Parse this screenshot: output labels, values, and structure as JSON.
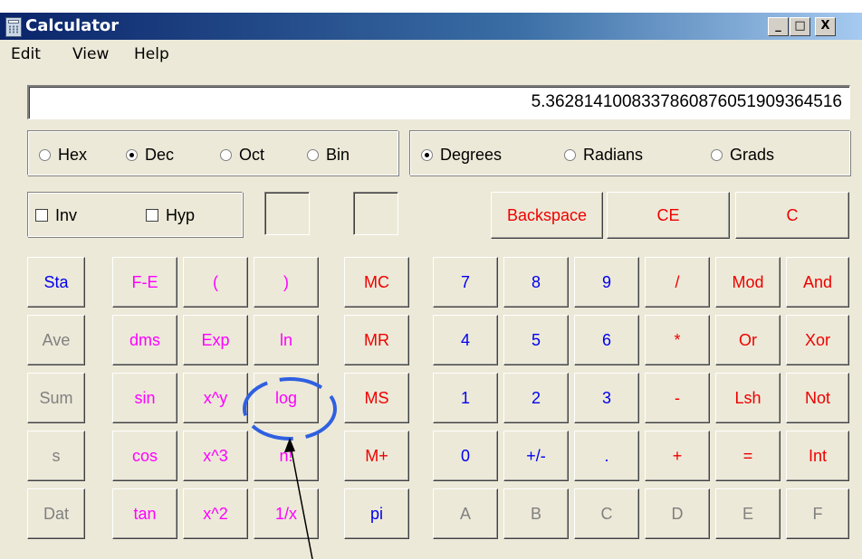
{
  "window": {
    "title": "Calculator"
  },
  "title_buttons": [
    "_",
    "□",
    "X"
  ],
  "menu": {
    "items": [
      "Edit",
      "View",
      "Help"
    ]
  },
  "display": {
    "value": "5.3628141008337860876051909364516"
  },
  "radix_options": [
    {
      "label": "Hex",
      "selected": false
    },
    {
      "label": "Dec",
      "selected": true
    },
    {
      "label": "Oct",
      "selected": false
    },
    {
      "label": "Bin",
      "selected": false
    }
  ],
  "angle_options": [
    {
      "label": "Degrees",
      "selected": true
    },
    {
      "label": "Radians",
      "selected": false
    },
    {
      "label": "Grads",
      "selected": false
    }
  ],
  "checkboxes": [
    {
      "label": "Inv",
      "checked": false
    },
    {
      "label": "Hyp",
      "checked": false
    }
  ],
  "edit_buttons": [
    {
      "label": "Backspace",
      "color": "#ee0000"
    },
    {
      "label": "CE",
      "color": "#ee0000"
    },
    {
      "label": "C",
      "color": "#ee0000"
    }
  ],
  "stat_buttons": [
    {
      "label": "Sta",
      "color": "#0000ee"
    },
    {
      "label": "Ave",
      "color": "#808080"
    },
    {
      "label": "Sum",
      "color": "#808080"
    },
    {
      "label": "s",
      "color": "#808080"
    },
    {
      "label": "Dat",
      "color": "#808080"
    }
  ],
  "func_col1": [
    "F-E",
    "dms",
    "sin",
    "cos",
    "tan"
  ],
  "func_col2": [
    "(",
    "Exp",
    "x^y",
    "x^3",
    "x^2"
  ],
  "func_col3": [
    ")",
    "ln",
    "log",
    "n!",
    "1/x"
  ],
  "memory_buttons": [
    {
      "label": "MC",
      "color": "#ee0000"
    },
    {
      "label": "MR",
      "color": "#ee0000"
    },
    {
      "label": "MS",
      "color": "#ee0000"
    },
    {
      "label": "M+",
      "color": "#ee0000"
    },
    {
      "label": "pi",
      "color": "#0000ee"
    }
  ],
  "keypad_rows": [
    [
      {
        "label": "7",
        "color": "#0000ee"
      },
      {
        "label": "8",
        "color": "#0000ee"
      },
      {
        "label": "9",
        "color": "#0000ee"
      },
      {
        "label": "/",
        "color": "#ee0000"
      },
      {
        "label": "Mod",
        "color": "#ee0000"
      },
      {
        "label": "And",
        "color": "#ee0000"
      }
    ],
    [
      {
        "label": "4",
        "color": "#0000ee"
      },
      {
        "label": "5",
        "color": "#0000ee"
      },
      {
        "label": "6",
        "color": "#0000ee"
      },
      {
        "label": "*",
        "color": "#ee0000"
      },
      {
        "label": "Or",
        "color": "#ee0000"
      },
      {
        "label": "Xor",
        "color": "#ee0000"
      }
    ],
    [
      {
        "label": "1",
        "color": "#0000ee"
      },
      {
        "label": "2",
        "color": "#0000ee"
      },
      {
        "label": "3",
        "color": "#0000ee"
      },
      {
        "label": "-",
        "color": "#ee0000"
      },
      {
        "label": "Lsh",
        "color": "#ee0000"
      },
      {
        "label": "Not",
        "color": "#ee0000"
      }
    ],
    [
      {
        "label": "0",
        "color": "#0000ee"
      },
      {
        "label": "+/-",
        "color": "#0000ee"
      },
      {
        "label": ".",
        "color": "#0000ee"
      },
      {
        "label": "+",
        "color": "#ee0000"
      },
      {
        "label": "=",
        "color": "#ee0000"
      },
      {
        "label": "Int",
        "color": "#ee0000"
      }
    ],
    [
      {
        "label": "A",
        "color": "#808080"
      },
      {
        "label": "B",
        "color": "#808080"
      },
      {
        "label": "C",
        "color": "#808080"
      },
      {
        "label": "D",
        "color": "#808080"
      },
      {
        "label": "E",
        "color": "#808080"
      },
      {
        "label": "F",
        "color": "#808080"
      }
    ]
  ],
  "colors": {
    "func_magenta": "#ff00ff",
    "annotation_blue": "#3060e0"
  }
}
